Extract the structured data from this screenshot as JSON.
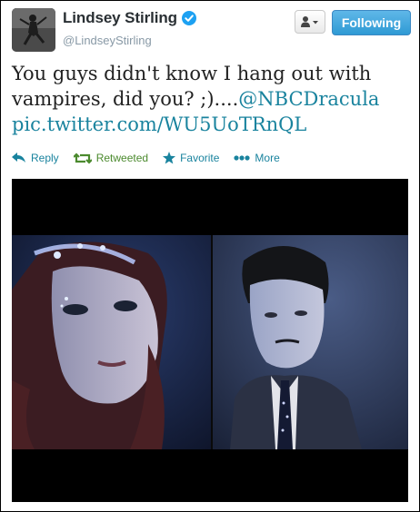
{
  "tweet": {
    "user": {
      "name": "Lindsey Stirling",
      "handle": "@LindseyStirling",
      "verified": true
    },
    "follow_button_label": "Following",
    "text": {
      "body": "You guys didn't know I hang out with vampires, did you? ;)....",
      "mention": "@NBCDracula",
      "pic_link": "pic.twitter.com/WU5UoTRnQL"
    },
    "actions": {
      "reply": "Reply",
      "retweeted": "Retweeted",
      "favorite": "Favorite",
      "more": "More"
    }
  },
  "colors": {
    "link": "#19839e",
    "retweeted": "#4b8a2e",
    "follow_button": "#2f9ad4",
    "verified_badge": "#1da1f2"
  },
  "icons": [
    "user-icon",
    "caret-down-icon",
    "verified-badge-icon",
    "reply-icon",
    "retweet-icon",
    "star-icon",
    "more-dots-icon"
  ]
}
